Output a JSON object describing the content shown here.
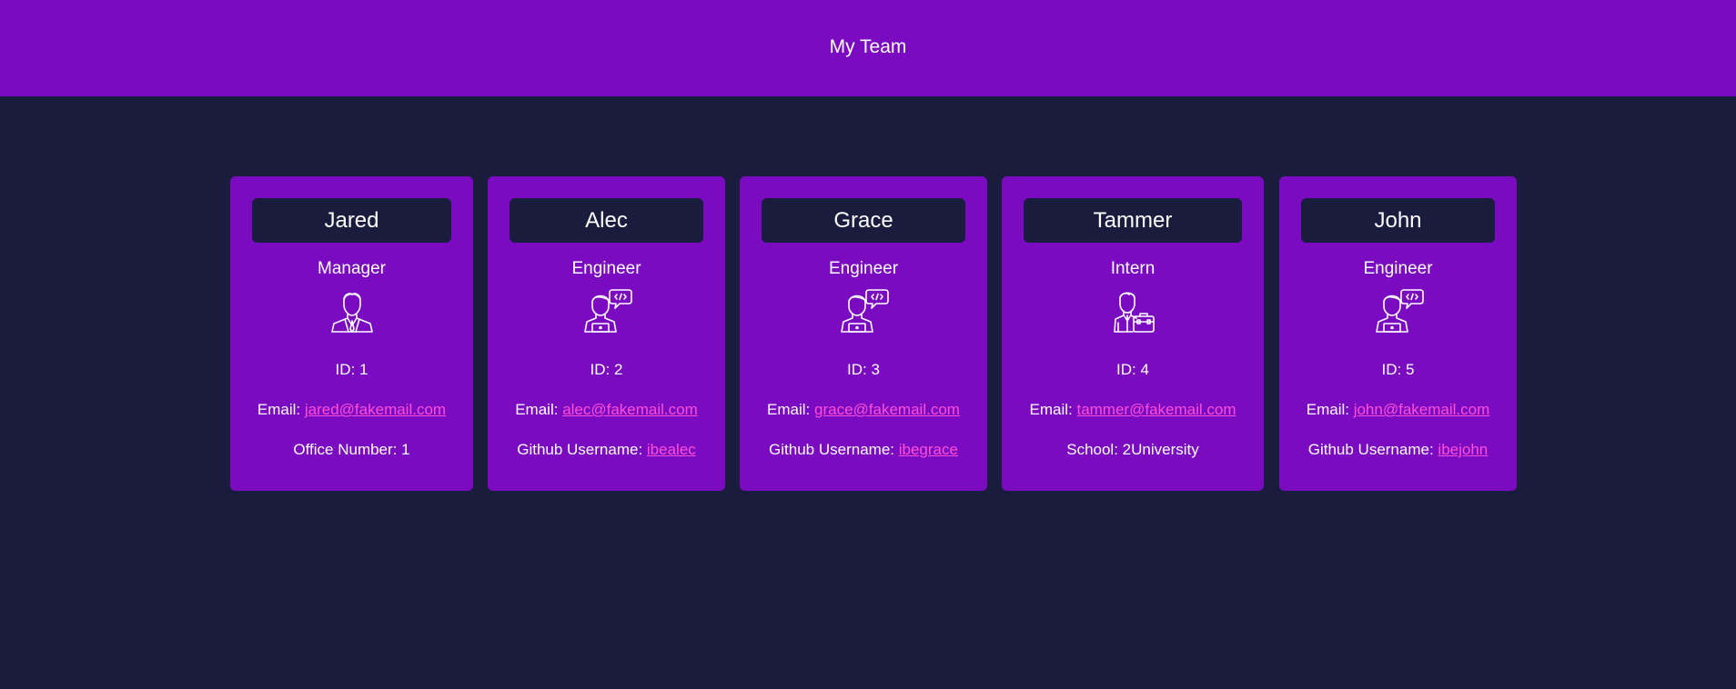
{
  "header": {
    "title": "My Team"
  },
  "labels": {
    "id": "ID: ",
    "email": "Email: ",
    "office": "Office Number: ",
    "github": "Github Username: ",
    "school": "School: "
  },
  "employees": [
    {
      "name": "Jared",
      "role": "Manager",
      "id": "1",
      "email": "jared@fakemail.com",
      "office": "1",
      "icon": "manager-icon"
    },
    {
      "name": "Alec",
      "role": "Engineer",
      "id": "2",
      "email": "alec@fakemail.com",
      "github": "ibealec",
      "icon": "engineer-icon"
    },
    {
      "name": "Grace",
      "role": "Engineer",
      "id": "3",
      "email": "grace@fakemail.com",
      "github": "ibegrace",
      "icon": "engineer-icon"
    },
    {
      "name": "Tammer",
      "role": "Intern",
      "id": "4",
      "email": "tammer@fakemail.com",
      "school": "2University",
      "icon": "intern-icon"
    },
    {
      "name": "John",
      "role": "Engineer",
      "id": "5",
      "email": "john@fakemail.com",
      "github": "ibejohn",
      "icon": "engineer-icon"
    }
  ],
  "colors": {
    "accent": "#7b0bc1",
    "background": "#1a1c3e",
    "link": "#ff4fd8"
  }
}
